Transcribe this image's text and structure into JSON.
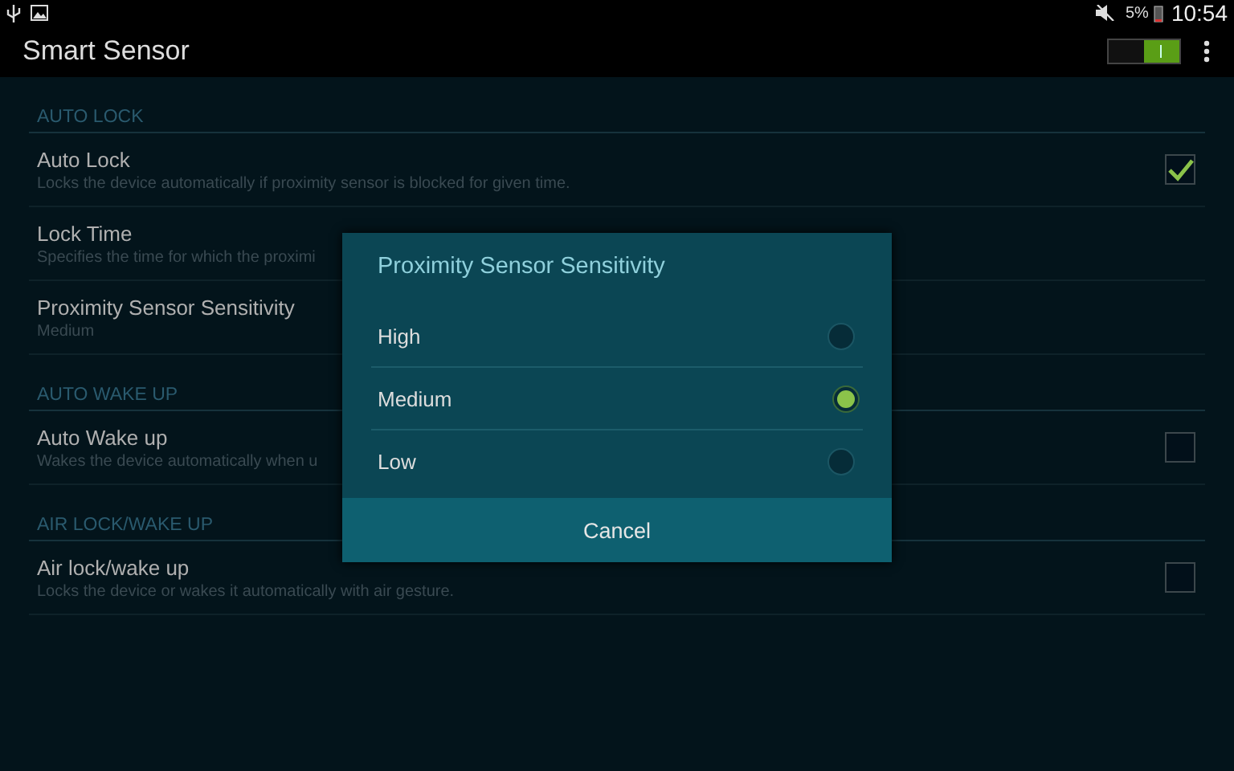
{
  "status_bar": {
    "battery": "5%",
    "time": "10:54"
  },
  "action_bar": {
    "title": "Smart Sensor",
    "master_switch": {
      "on": true
    }
  },
  "sections": [
    {
      "header": "AUTO LOCK",
      "items": [
        {
          "kind": "checkbox",
          "title": "Auto Lock",
          "summary": "Locks the device automatically if proximity sensor is blocked for given time.",
          "checked": true
        },
        {
          "kind": "plain",
          "title": "Lock Time",
          "summary": "Specifies the time for which the proximi"
        },
        {
          "kind": "plain",
          "title": "Proximity Sensor Sensitivity",
          "summary": "Medium"
        }
      ]
    },
    {
      "header": "AUTO WAKE UP",
      "items": [
        {
          "kind": "checkbox",
          "title": "Auto Wake up",
          "summary": "Wakes the device automatically when u",
          "checked": false
        }
      ]
    },
    {
      "header": "AIR LOCK/WAKE UP",
      "items": [
        {
          "kind": "checkbox",
          "title": "Air lock/wake up",
          "summary": "Locks the device or wakes it automatically with air gesture.",
          "checked": false
        }
      ]
    }
  ],
  "dialog": {
    "title": "Proximity Sensor Sensitivity",
    "options": [
      {
        "label": "High",
        "selected": false
      },
      {
        "label": "Medium",
        "selected": true
      },
      {
        "label": "Low",
        "selected": false
      }
    ],
    "cancel": "Cancel"
  }
}
